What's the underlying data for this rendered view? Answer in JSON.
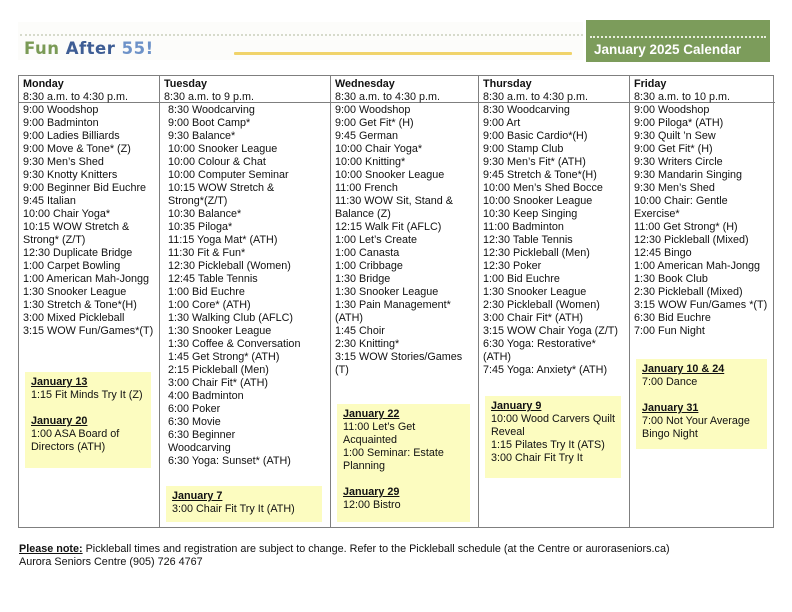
{
  "header": {
    "logo_part1": "Fun ",
    "logo_part2": "After ",
    "logo_part3": "55!",
    "title": "January 2025 Calendar",
    "colors": {
      "green": "#7c9c5b",
      "blue": "#3e5d94",
      "light_blue": "#6d92c8",
      "gold": "#f0d36a",
      "highlight": "#fcfcc0"
    }
  },
  "days": [
    {
      "name": "Monday",
      "hours": " 8:30 a.m. to 4:30 p.m.",
      "activities": [
        "9:00 Woodshop",
        "9:00 Badminton",
        "9:00 Ladies Billiards",
        "9:00 Move & Tone* (Z)",
        "9:30 Men’s Shed",
        "9:30 Knotty Knitters",
        "9:00 Beginner Bid Euchre",
        "9:45 Italian",
        "10:00 Chair Yoga*",
        "10:15 WOW Stretch &",
        "Strong* (Z/T)",
        "12:30 Duplicate Bridge",
        "1:00 Carpet Bowling",
        "1:00 American Mah-Jongg",
        "1:30 Snooker League",
        "1:30 Stretch & Tone*(H)",
        "3:00 Mixed Pickleball",
        "3:15 WOW Fun/Games*(T)"
      ],
      "specials": [
        {
          "date": "January 13",
          "events": [
            "1:15 Fit Minds Try It (Z)"
          ]
        },
        {
          "date": "January 20",
          "events": [
            "1:00 ASA Board of",
            "Directors (ATH)"
          ]
        }
      ]
    },
    {
      "name": "Tuesday",
      "hours": "8:30 a.m. to 9 p.m.",
      "activities": [
        "8:30 Woodcarving",
        "9:00 Boot Camp*",
        "9:30 Balance*",
        "10:00 Snooker League",
        "10:00 Colour & Chat",
        "10:00 Computer Seminar",
        "10:15 WOW Stretch &",
        "Strong*(Z/T)",
        "10:30 Balance*",
        "10:35 Piloga*",
        "11:15 Yoga Mat* (ATH)",
        "11:30 Fit & Fun*",
        "12:30 Pickleball (Women)",
        "12:45 Table Tennis",
        "1:00 Bid Euchre",
        "1:00 Core* (ATH)",
        "1:30 Walking Club (AFLC)",
        "1:30 Snooker League",
        "1:30 Coffee & Conversation",
        "1:45 Get Strong* (ATH)",
        "2:15 Pickleball (Men)",
        "3:00 Chair Fit* (ATH)",
        "4:00 Badminton",
        "6:00 Poker",
        "6:30 Movie",
        "6:30 Beginner",
        "Woodcarving",
        "6:30 Yoga: Sunset* (ATH)"
      ],
      "specials": [
        {
          "date": "January 7",
          "events": [
            "3:00 Chair Fit Try It (ATH)"
          ]
        }
      ]
    },
    {
      "name": "Wednesday",
      "hours": "8:30 a.m. to 4:30 p.m.",
      "activities": [
        "9:00 Woodshop",
        "9:00 Get Fit* (H)",
        "9:45 German",
        "10:00 Chair Yoga*",
        "10:00 Knitting*",
        "10:00 Snooker League",
        "11:00 French",
        "11:30 WOW Sit, Stand &",
        "Balance (Z)",
        "12:15 Walk Fit (AFLC)",
        "1:00 Let’s Create",
        "1:00 Canasta",
        "1:00 Cribbage",
        "1:30 Bridge",
        "1:30 Snooker League",
        "1:30 Pain Management*",
        "(ATH)",
        "1:45 Choir",
        "2:30 Knitting*",
        "3:15 WOW Stories/Games",
        "(T)"
      ],
      "specials": [
        {
          "date": "January 22",
          "events": [
            "11:00 Let’s Get",
            "Acquainted",
            "1:00 Seminar: Estate",
            "Planning"
          ]
        },
        {
          "date": "January 29",
          "events": [
            "12:00 Bistro"
          ]
        }
      ]
    },
    {
      "name": "Thursday",
      "hours": "8:30 a.m. to 4:30 p.m.",
      "activities": [
        "8:30 Woodcarving",
        "9:00 Art",
        "9:00 Basic Cardio*(H)",
        "9:00 Stamp Club",
        "9:30 Men’s Fit* (ATH)",
        "9:45 Stretch & Tone*(H)",
        "10:00 Men’s Shed Bocce",
        "10:00 Snooker League",
        "10:30 Keep Singing",
        "11:00 Badminton",
        "12:30 Table Tennis",
        "12:30 Pickleball (Men)",
        "12:30 Poker",
        "1:00 Bid Euchre",
        "1:30 Snooker League",
        "2:30 Pickleball (Women)",
        "3:00 Chair Fit* (ATH)",
        "3:15 WOW Chair Yoga (Z/T)",
        "6:30 Yoga: Restorative*",
        "(ATH)",
        "7:45 Yoga: Anxiety* (ATH)"
      ],
      "specials": [
        {
          "date": "January 9",
          "events": [
            "10:00 Wood Carvers Quilt",
            "Reveal",
            "1:15 Pilates Try It (ATS)",
            "3:00 Chair Fit Try It"
          ]
        }
      ]
    },
    {
      "name": "Friday",
      "hours": "8:30 a.m. to 10 p.m.",
      "activities": [
        "9:00 Woodshop",
        "9:00 Piloga* (ATH)",
        "9:30 Quilt ’n Sew",
        "9:00 Get Fit* (H)",
        "9:30 Writers Circle",
        "9:30 Mandarin Singing",
        "9:30 Men’s Shed",
        "10:00 Chair: Gentle",
        "Exercise*",
        "11:00 Get Strong* (H)",
        "12:30 Pickleball (Mixed)",
        "12:45 Bingo",
        "1:00 American Mah-Jongg",
        "1:30 Book Club",
        "2:30 Pickleball (Mixed)",
        "3:15 WOW Fun/Games *(T)",
        "6:30 Bid Euchre",
        "7:00 Fun Night"
      ],
      "specials": [
        {
          "date": "January 10 & 24",
          "events": [
            "7:00 Dance"
          ]
        },
        {
          "date": "January 31",
          "events": [
            "7:00 Not Your Average",
            "Bingo Night"
          ]
        }
      ]
    }
  ],
  "footer": {
    "note_label": "Please note:",
    "note_text": " Pickleball times and registration are subject to change. Refer to the Pickleball schedule (at the Centre or auroraseniors.ca)",
    "address": "Aurora Seniors Centre (905) 726 4767"
  }
}
